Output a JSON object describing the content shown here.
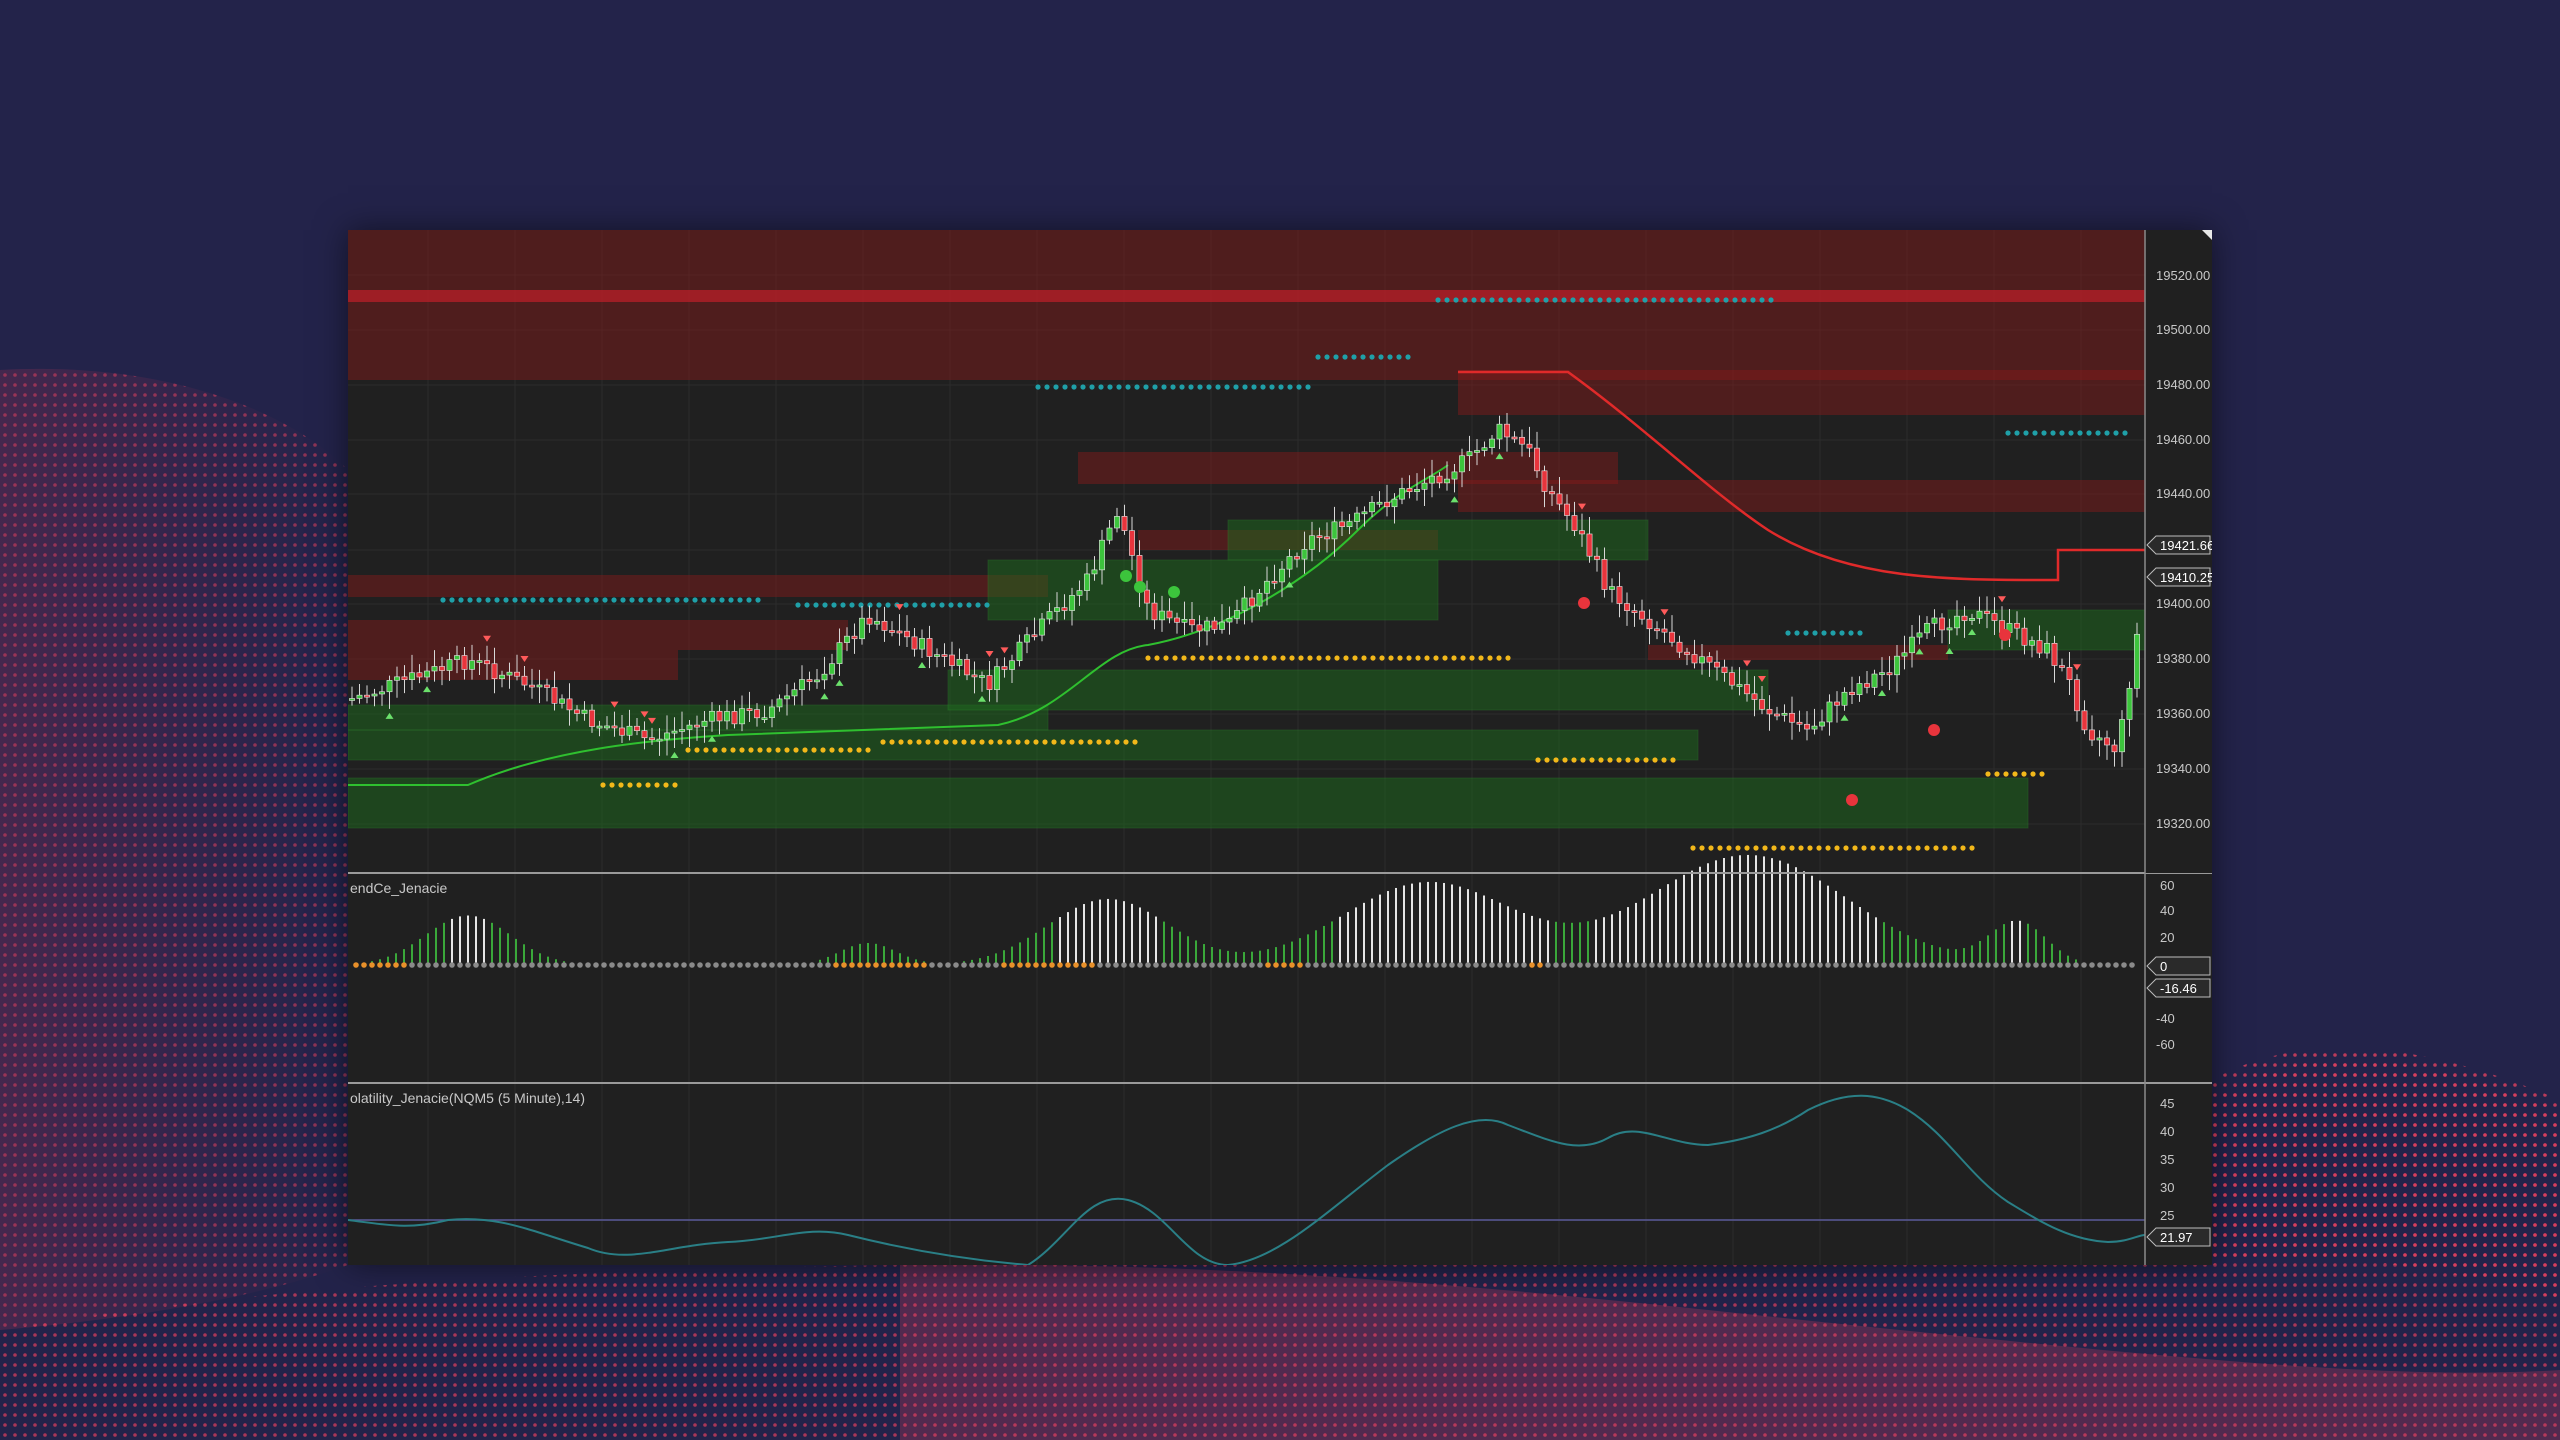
{
  "colors": {
    "background": "#23234a",
    "chart_bg": "#202020",
    "up_candle": "#3cc43c",
    "down_candle": "#e8343c",
    "cyan_dots": "#1fa0a8",
    "yellow_dots": "#f2b81a",
    "resistance_zone": "#8a1a1a",
    "support_zone": "#1e6a1e",
    "volatility_line": "#2a7f86",
    "volatility_level": "#5a5a9a"
  },
  "price_pane": {
    "y_axis": {
      "labels": [
        "19520.00",
        "19500.00",
        "19480.00",
        "19460.00",
        "19440.00",
        "19400.00",
        "19380.00",
        "19360.00",
        "19340.00",
        "19320.00"
      ],
      "price_tags": [
        "19421.66",
        "19410.25"
      ]
    }
  },
  "trend_pane": {
    "title": "endCe_Jenacie",
    "y_axis": {
      "labels": [
        "60",
        "40",
        "20",
        "-40",
        "-60"
      ],
      "value_tags": [
        "0",
        "-16.46"
      ]
    }
  },
  "volatility_pane": {
    "title": "olatility_Jenacie(NQM5 (5 Minute),14)",
    "y_axis": {
      "labels": [
        "45",
        "40",
        "35",
        "30",
        "25"
      ],
      "value_tags": [
        "21.97"
      ]
    }
  }
}
